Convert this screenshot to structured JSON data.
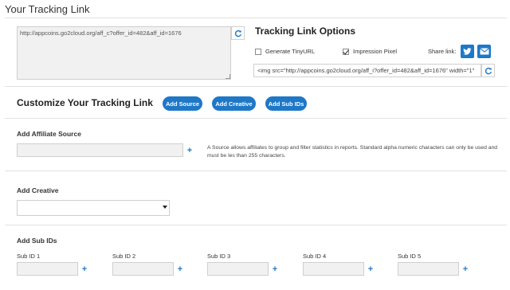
{
  "header": {
    "title": "Your Tracking Link"
  },
  "tracking_link": {
    "url": "http://appcoins.go2cloud.org/aff_c?offer_id=482&aff_id=1676",
    "refresh_icon": "refresh-icon"
  },
  "options": {
    "title": "Tracking Link Options",
    "generate_tinyurl": {
      "label": "Generate TinyURL",
      "checked": false
    },
    "impression_pixel": {
      "label": "Impression Pixel",
      "checked": true
    },
    "share_label": "Share link:",
    "share_buttons": [
      "twitter-icon",
      "email-icon"
    ],
    "pixel_code": "<img src=\"http://appcoins.go2cloud.org/aff_i?offer_id=482&aff_id=1676\" width=\"1\""
  },
  "customize": {
    "title": "Customize Your Tracking Link",
    "buttons": [
      "Add Source",
      "Add Creative",
      "Add Sub IDs"
    ]
  },
  "affiliate_source": {
    "label": "Add Affiliate Source",
    "value": "",
    "help": "A Source allows affiliates to group and filter statistics in reports. Standard alpha numeric characters can only be used and must be les than 255 characters."
  },
  "creative": {
    "label": "Add Creative",
    "selected": ""
  },
  "sub_ids": {
    "label": "Add Sub IDs",
    "items": [
      {
        "label": "Sub ID 1",
        "value": ""
      },
      {
        "label": "Sub ID 2",
        "value": ""
      },
      {
        "label": "Sub ID 3",
        "value": ""
      },
      {
        "label": "Sub ID 4",
        "value": ""
      },
      {
        "label": "Sub ID 5",
        "value": ""
      }
    ]
  },
  "colors": {
    "accent": "#1e78c8",
    "input_bg": "#f1f1f1",
    "border": "#cfcfcf"
  }
}
